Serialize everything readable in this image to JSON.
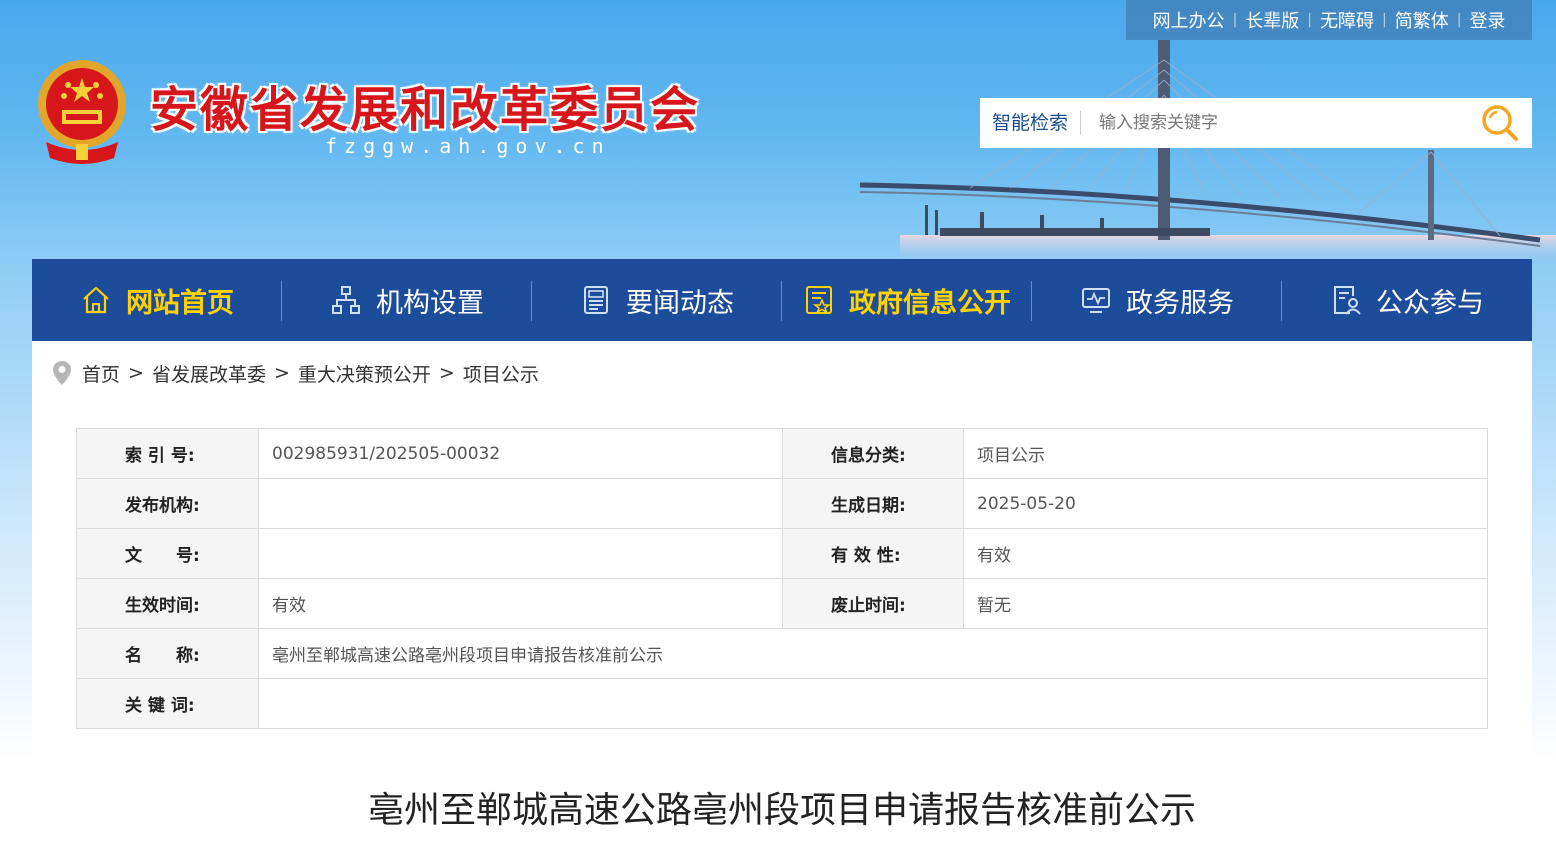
{
  "topbar": {
    "links": [
      "网上办公",
      "长辈版",
      "无障碍",
      "简繁体",
      "登录"
    ]
  },
  "header": {
    "title": "安徽省发展和改革委员会",
    "domain": "fzggw.ah.gov.cn"
  },
  "search": {
    "label": "智能检索",
    "placeholder": "输入搜索关键字"
  },
  "nav": {
    "items": [
      "网站首页",
      "机构设置",
      "要闻动态",
      "政府信息公开",
      "政务服务",
      "公众参与"
    ],
    "active_color": "#ffd200",
    "background": "#1d4c9a"
  },
  "breadcrumb": {
    "items": [
      "首页",
      "省发展改革委",
      "重大决策预公开",
      "项目公示"
    ],
    "sep": ">"
  },
  "meta": {
    "index_label": "索 引 号:",
    "index_value": "002985931/202505-00032",
    "category_label": "信息分类:",
    "category_value": "项目公示",
    "publisher_label": "发布机构:",
    "publisher_value": "",
    "date_label": "生成日期:",
    "date_value": "2025-05-20",
    "docno_label": "文　　号:",
    "docno_value": "",
    "validity_label": "有 效 性:",
    "validity_value": "有效",
    "effective_label": "生效时间:",
    "effective_value": "有效",
    "expire_label": "废止时间:",
    "expire_value": "暂无",
    "name_label": "名　　称:",
    "name_value": "亳州至郸城高速公路亳州段项目申请报告核准前公示",
    "keywords_label": "关 键 词:",
    "keywords_value": ""
  },
  "document": {
    "title": "亳州至郸城高速公路亳州段项目申请报告核准前公示"
  }
}
